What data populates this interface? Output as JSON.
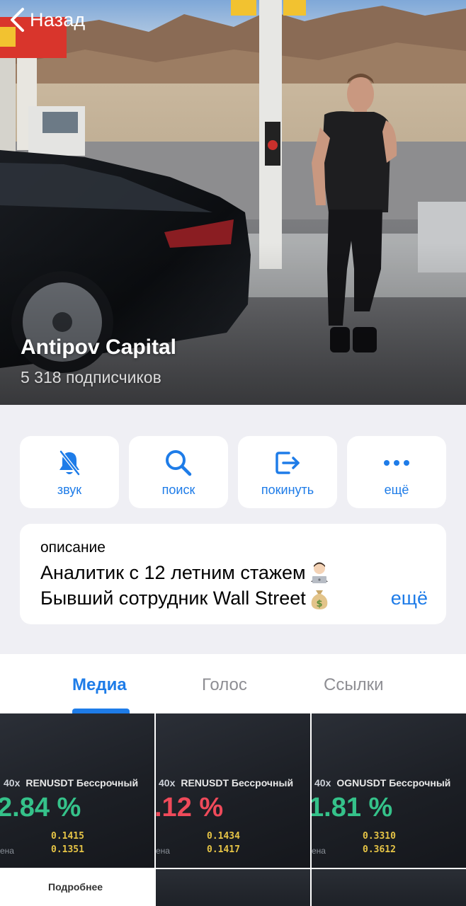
{
  "header": {
    "back_label": "Назад"
  },
  "channel": {
    "name": "Antipov Capital",
    "subscribers": "5 318 подписчиков"
  },
  "actions": [
    {
      "label": "звук",
      "icon": "bell-slash-icon"
    },
    {
      "label": "поиск",
      "icon": "search-icon"
    },
    {
      "label": "покинуть",
      "icon": "leave-icon"
    },
    {
      "label": "ещё",
      "icon": "more-icon"
    }
  ],
  "description": {
    "title": "описание",
    "line1": "Аналитик с 12 летним стажем",
    "line2": "Бывший сотрудник Wall Street",
    "more": "ещё"
  },
  "tabs": {
    "media": "Медиа",
    "voice": "Голос",
    "links": "Ссылки"
  },
  "media": [
    {
      "leverage": "40x",
      "symbol": "RENUSDT Бессрочный",
      "percent": "2.84 %",
      "price1": "0.1415",
      "price2": "0.1351",
      "side_label": "ена",
      "color": "#35c28a"
    },
    {
      "leverage": "40x",
      "symbol": "RENUSDT Бессрочный",
      "percent": ".12 %",
      "price1": "0.1434",
      "price2": "0.1417",
      "side_label": "ена",
      "color": "#ef4a5a"
    },
    {
      "leverage": "40x",
      "symbol": "OGNUSDT Бессрочный",
      "percent": "1.81 %",
      "price1": "0.3310",
      "price2": "0.3612",
      "side_label": "ена",
      "color": "#35c28a"
    }
  ],
  "media_more": "Подробнее",
  "colors": {
    "accent": "#1e7ce8",
    "background": "#efeff4",
    "card": "#ffffff"
  }
}
